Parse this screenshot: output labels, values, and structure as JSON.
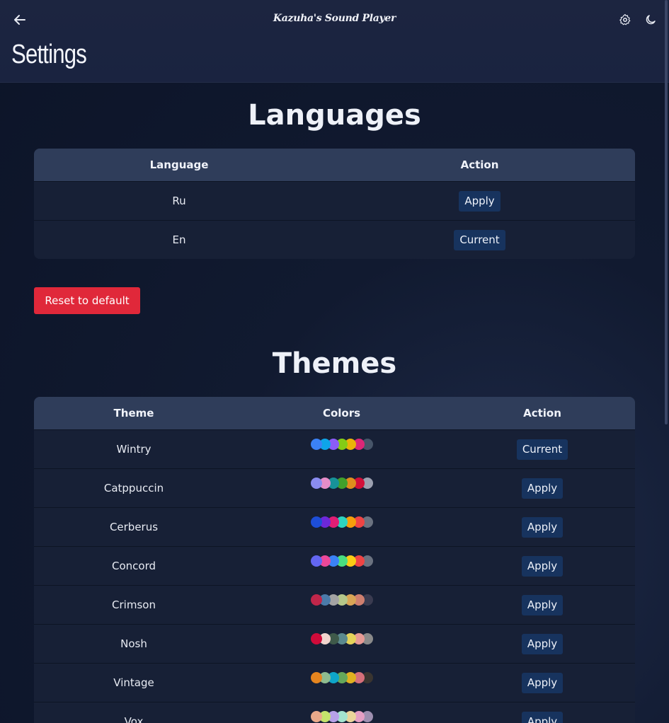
{
  "app": {
    "title": "Kazuha's Sound Player",
    "page_title": "Settings",
    "icons": {
      "back": "arrow-left-icon",
      "settings": "gear-icon",
      "theme": "moon-icon"
    }
  },
  "languages": {
    "title": "Languages",
    "headers": {
      "language": "Language",
      "action": "Action"
    },
    "rows": [
      {
        "name": "Ru",
        "action": "Apply"
      },
      {
        "name": "En",
        "action": "Current"
      }
    ]
  },
  "reset_label": "Reset to default",
  "themes": {
    "title": "Themes",
    "headers": {
      "theme": "Theme",
      "colors": "Colors",
      "action": "Action"
    },
    "rows": [
      {
        "name": "Wintry",
        "action": "Current",
        "colors": [
          "#3b82f6",
          "#0ea5e9",
          "#8b5cf6",
          "#84cc16",
          "#eab308",
          "#db2777",
          "#475569"
        ]
      },
      {
        "name": "Catppuccin",
        "action": "Apply",
        "colors": [
          "#8a8cf0",
          "#e68dc8",
          "#179299",
          "#40a02b",
          "#df8e1d",
          "#d20f39",
          "#9ca0b0"
        ]
      },
      {
        "name": "Cerberus",
        "action": "Apply",
        "colors": [
          "#1d4ed8",
          "#6d28d9",
          "#e11d74",
          "#2dd4bf",
          "#f59e0b",
          "#ef4444",
          "#6b7280"
        ]
      },
      {
        "name": "Concord",
        "action": "Apply",
        "colors": [
          "#6366f1",
          "#ec4899",
          "#3b82f6",
          "#4ade80",
          "#facc15",
          "#ef4444",
          "#6b7280"
        ]
      },
      {
        "name": "Crimson",
        "action": "Apply",
        "colors": [
          "#c0264a",
          "#4b7baa",
          "#a3a3a3",
          "#b5c78a",
          "#d9a556",
          "#cf7f6f",
          "#3a3b50"
        ]
      },
      {
        "name": "Nosh",
        "action": "Apply",
        "colors": [
          "#d00b3a",
          "#f1d5cf",
          "#3f5a4a",
          "#5b8a8e",
          "#e4d25a",
          "#e79a95",
          "#8a8a8a"
        ]
      },
      {
        "name": "Vintage",
        "action": "Apply",
        "colors": [
          "#e5851f",
          "#8fbc8f",
          "#0ea5c9",
          "#65a85a",
          "#e0b020",
          "#d66f7a",
          "#3a3530"
        ]
      },
      {
        "name": "Vox",
        "action": "Apply",
        "colors": [
          "#e9a98a",
          "#c4e36c",
          "#b7a1e8",
          "#a3e4cf",
          "#ebd59a",
          "#e69fc4",
          "#9e8fb0"
        ]
      }
    ]
  }
}
